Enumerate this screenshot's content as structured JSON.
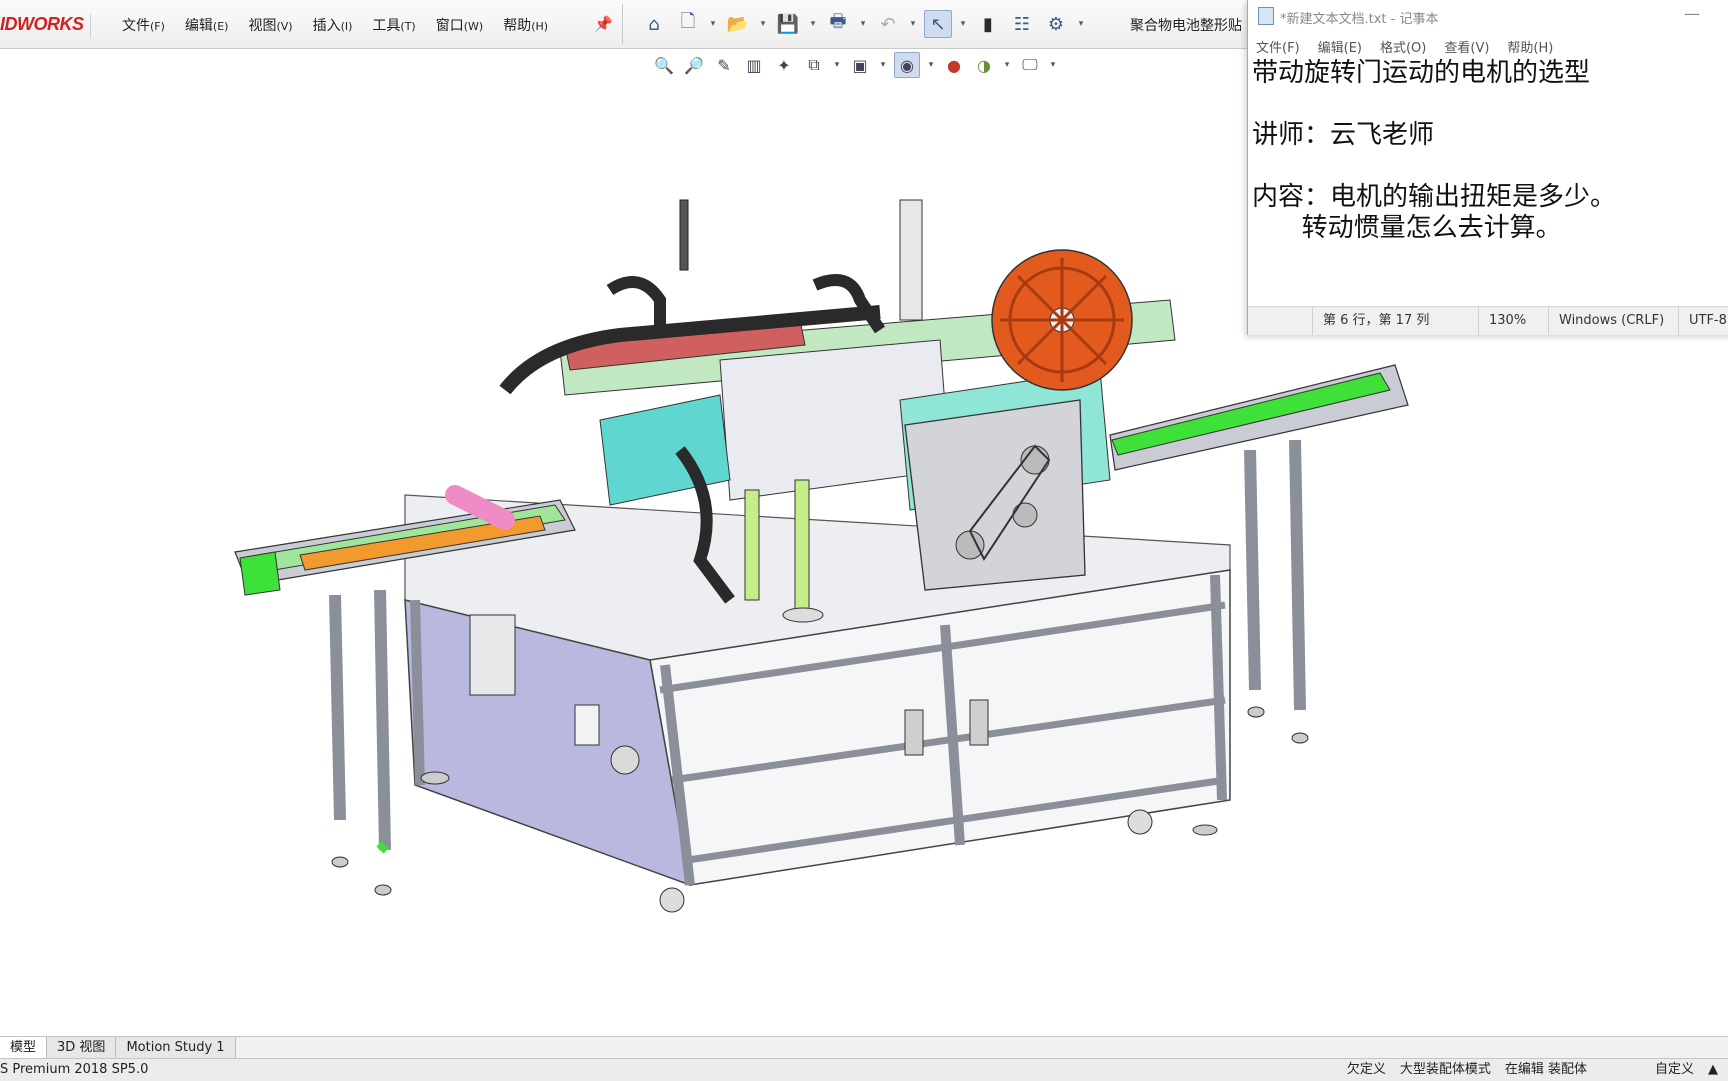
{
  "solidworks": {
    "logo_text": "IDWORKS",
    "menu": [
      {
        "label": "文件",
        "key": "(F)"
      },
      {
        "label": "编辑",
        "key": "(E)"
      },
      {
        "label": "视图",
        "key": "(V)"
      },
      {
        "label": "插入",
        "key": "(I)"
      },
      {
        "label": "工具",
        "key": "(T)"
      },
      {
        "label": "窗口",
        "key": "(W)"
      },
      {
        "label": "帮助",
        "key": "(H)"
      }
    ],
    "document_title": "聚合物电池整形贴",
    "toolbar_icons": [
      "home-icon",
      "new-document-icon",
      "open-folder-icon",
      "save-icon",
      "print-icon",
      "undo-icon",
      "select-pointer-icon",
      "traffic-light-icon",
      "file-properties-icon",
      "options-gear-icon"
    ],
    "view_toolbar_icons": [
      "zoom-to-fit-icon",
      "zoom-area-icon",
      "previous-view-icon",
      "section-view-icon",
      "dynamic-annotation-icon",
      "view-orientation-icon",
      "display-style-icon",
      "hide-show-items-icon",
      "edit-appearance-icon",
      "apply-scene-icon",
      "view-settings-icon"
    ],
    "bottom_tabs": [
      "模型",
      "3D 视图",
      "Motion Study 1"
    ],
    "status_version": "S Premium 2018 SP5.0",
    "status_items": [
      "欠定义",
      "大型装配体模式",
      "在编辑 装配体",
      "",
      "自定义",
      "▲"
    ]
  },
  "notepad": {
    "title": "*新建文本文档.txt - 记事本",
    "menu": [
      "文件(F)",
      "编辑(E)",
      "格式(O)",
      "查看(V)",
      "帮助(H)"
    ],
    "lines": [
      "带动旋转门运动的电机的选型",
      "",
      "讲师：云飞老师",
      "",
      "内容：电机的输出扭矩是多少。",
      "      转动惯量怎么去计算。"
    ],
    "status": {
      "position": "第 6 行，第 17 列",
      "zoom": "130%",
      "line_ending": "Windows (CRLF)",
      "encoding": "UTF-8"
    }
  },
  "colors": {
    "logo_red": "#d42020",
    "reel_orange": "#e35a1e",
    "conveyor_green": "#3ee03a",
    "belt_orange": "#f29a2e",
    "frame_grey": "#c9ccd4",
    "cable_chain": "#2a2a2a",
    "panel_lavender": "#b9b8de"
  }
}
